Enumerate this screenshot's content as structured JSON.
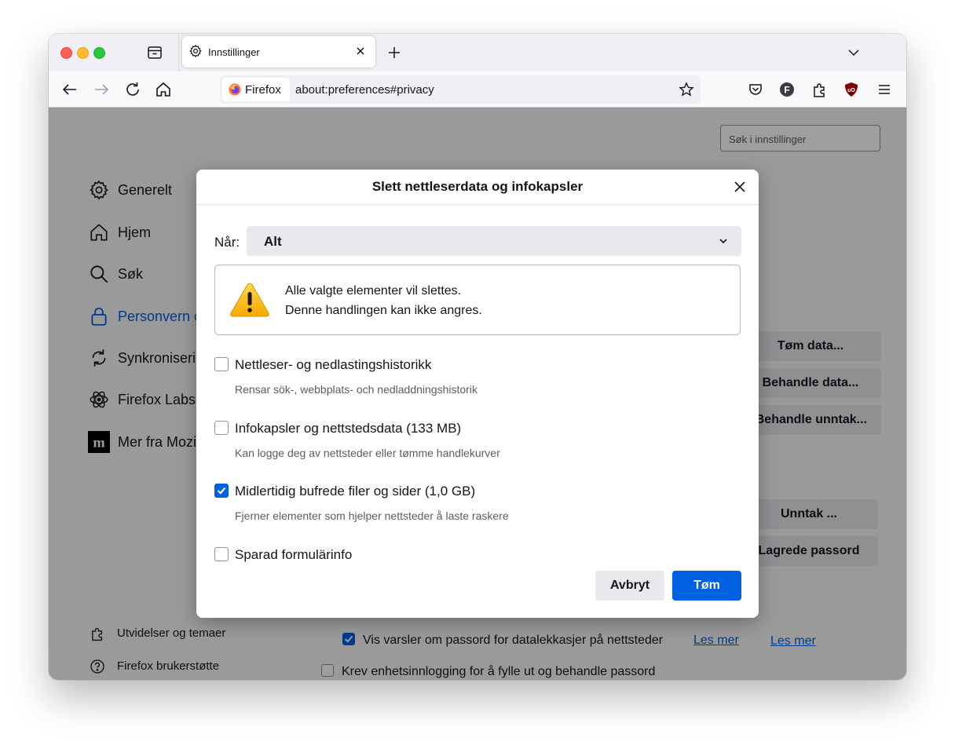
{
  "tab": {
    "title": "Innstillinger"
  },
  "urlbar": {
    "identity_label": "Firefox",
    "url": "about:preferences#privacy"
  },
  "settings": {
    "search_placeholder": "Søk i innstillinger",
    "nav": [
      {
        "label": "Generelt",
        "icon": "gear-icon"
      },
      {
        "label": "Hjem",
        "icon": "home-icon"
      },
      {
        "label": "Søk",
        "icon": "search-icon"
      },
      {
        "label": "Personvern og sikkerhet",
        "icon": "lock-icon",
        "active": true
      },
      {
        "label": "Synkronisering",
        "icon": "sync-icon"
      },
      {
        "label": "Firefox Labs",
        "icon": "labs-icon"
      },
      {
        "label": "Mer fra Mozilla",
        "icon": "mozilla-icon"
      }
    ],
    "footer": [
      {
        "label": "Utvidelser og temaer",
        "icon": "puzzle-icon"
      },
      {
        "label": "Firefox brukerstøtte",
        "icon": "help-icon"
      }
    ],
    "buttons": {
      "clear_data": "Tøm data...",
      "manage_data": "Behandle data...",
      "manage_exceptions": "Behandle unntak...",
      "exceptions": "Unntak ...",
      "saved_passwords": "Lagrede passord"
    },
    "learn_more": "Les mer",
    "breach_alerts_label": "Vis varsler om passord for datalekkasjer på nettsteder",
    "device_auth_label": "Krev enhetsinnlogging for å fylle ut og behandle passord"
  },
  "dialog": {
    "title": "Slett nettleserdata og infokapsler",
    "when_label": "Når:",
    "when_value": "Alt",
    "warning_line1": "Alle valgte elementer vil slettes.",
    "warning_line2": "Denne handlingen kan ikke angres.",
    "options": [
      {
        "label": "Nettleser- og nedlastingshistorikk",
        "description": "Rensar sök-, webbplats- och nedladdningshistorik",
        "checked": false
      },
      {
        "label": "Infokapsler og nettstedsdata (133 MB)",
        "description": "Kan logge deg av nettsteder eller tømme handlekurver",
        "checked": false
      },
      {
        "label": "Midlertidig bufrede filer og sider (1,0 GB)",
        "description": "Fjerner elementer som hjelper nettsteder å laste raskere",
        "checked": true
      },
      {
        "label": "Sparad formulärinfo",
        "description": "",
        "checked": false
      }
    ],
    "cancel_label": "Avbryt",
    "clear_label": "Tøm"
  },
  "colors": {
    "accent": "#0061e0",
    "warning": "#ffbf00"
  }
}
